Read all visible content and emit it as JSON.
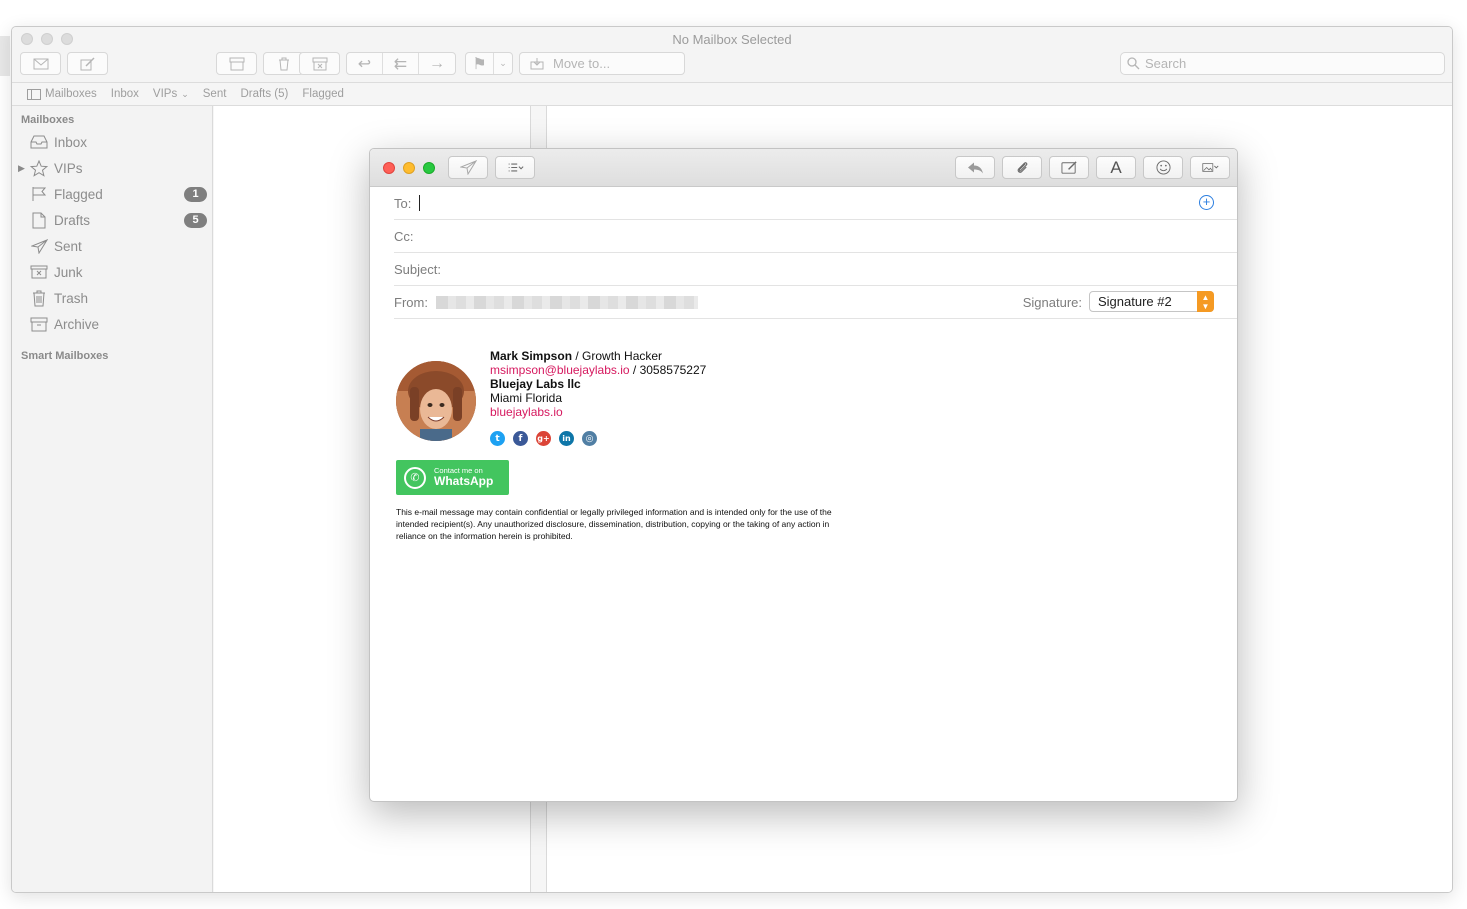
{
  "window": {
    "title": "No Mailbox Selected"
  },
  "toolbar": {
    "move_to_label": "Move to...",
    "search_placeholder": "Search"
  },
  "favorites": [
    {
      "label": "Mailboxes",
      "icon": "sidebar-icon"
    },
    {
      "label": "Inbox"
    },
    {
      "label": "VIPs",
      "icon": "chevron-down-icon"
    },
    {
      "label": "Sent"
    },
    {
      "label": "Drafts (5)"
    },
    {
      "label": "Flagged"
    }
  ],
  "sidebar": {
    "heading": "Mailboxes",
    "smart_heading": "Smart Mailboxes",
    "items": [
      {
        "label": "Inbox",
        "icon": "inbox-icon",
        "badge": ""
      },
      {
        "label": "VIPs",
        "icon": "star-icon",
        "badge": ""
      },
      {
        "label": "Flagged",
        "icon": "flag-icon",
        "badge": "1"
      },
      {
        "label": "Drafts",
        "icon": "document-icon",
        "badge": "5"
      },
      {
        "label": "Sent",
        "icon": "paper-plane-icon",
        "badge": ""
      },
      {
        "label": "Junk",
        "icon": "junk-icon",
        "badge": ""
      },
      {
        "label": "Trash",
        "icon": "trash-icon",
        "badge": ""
      },
      {
        "label": "Archive",
        "icon": "archive-icon",
        "badge": ""
      }
    ]
  },
  "compose": {
    "to_label": "To:",
    "cc_label": "Cc:",
    "subject_label": "Subject:",
    "from_label": "From:",
    "signature_label": "Signature:",
    "signature_value": "Signature #2",
    "font_button": "A"
  },
  "signature": {
    "name": "Mark Simpson",
    "role": " / Growth Hacker",
    "email": "msimpson@bluejaylabs.io",
    "phone": " / 3058575227",
    "company": "Bluejay Labs llc",
    "location": "Miami Florida",
    "website": "bluejaylabs.io",
    "socials": [
      {
        "icon": "twitter-icon",
        "color": "#1da1f2",
        "glyph": "t"
      },
      {
        "icon": "facebook-icon",
        "color": "#3b5998",
        "glyph": "f"
      },
      {
        "icon": "google-plus-icon",
        "color": "#db4437",
        "glyph": "g+"
      },
      {
        "icon": "linkedin-icon",
        "color": "#0e76a8",
        "glyph": "in"
      },
      {
        "icon": "instagram-icon",
        "color": "#517fa4",
        "glyph": "◎"
      }
    ],
    "whatsapp_line1": "Contact me on",
    "whatsapp_line2": "WhatsApp",
    "disclaimer": "This e-mail message may contain confidential or legally privileged information and is intended only for the use of the intended recipient(s). Any unauthorized disclosure, dissemination, distribution, copying or the taking of any action in reliance on the information herein is prohibited."
  },
  "colors": {
    "accent_blue": "#2d7fe0",
    "stepper_orange": "#f59a23",
    "signature_pink": "#d6195f",
    "whatsapp_green": "#43c55f",
    "close_red": "#fe5f57",
    "minimize_yellow": "#febc2e",
    "zoom_green": "#28c840"
  }
}
